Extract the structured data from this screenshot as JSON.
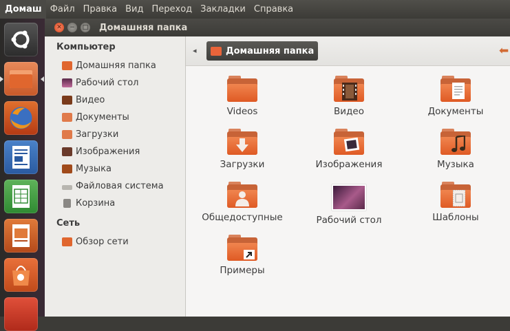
{
  "menubar": {
    "app_name": "Домаш",
    "items": [
      "Файл",
      "Правка",
      "Вид",
      "Переход",
      "Закладки",
      "Справка"
    ]
  },
  "window": {
    "title": "Домашняя папка",
    "controls": [
      "close-icon",
      "minimize-icon",
      "maximize-icon"
    ]
  },
  "launcher": {
    "items": [
      "ubuntu-dash-icon",
      "home-folder-icon",
      "firefox-icon",
      "writer-icon",
      "calc-icon",
      "impress-icon",
      "software-center-icon",
      "help-icon"
    ]
  },
  "sidebar": {
    "computer_header": "Компьютер",
    "computer_items": [
      {
        "label": "Домашняя папка",
        "icon": "home-folder-icon"
      },
      {
        "label": "Рабочий стол",
        "icon": "desktop-icon"
      },
      {
        "label": "Видео",
        "icon": "video-icon"
      },
      {
        "label": "Документы",
        "icon": "documents-icon"
      },
      {
        "label": "Загрузки",
        "icon": "downloads-icon"
      },
      {
        "label": "Изображения",
        "icon": "pictures-icon"
      },
      {
        "label": "Музыка",
        "icon": "music-icon"
      },
      {
        "label": "Файловая система",
        "icon": "filesystem-icon"
      },
      {
        "label": "Корзина",
        "icon": "trash-icon"
      }
    ],
    "network_header": "Сеть",
    "network_items": [
      {
        "label": "Обзор сети",
        "icon": "network-icon"
      }
    ]
  },
  "toolbar": {
    "breadcrumb": "Домашняя папка"
  },
  "files": [
    {
      "name": "Videos",
      "icon": "folder-icon"
    },
    {
      "name": "Видео",
      "icon": "video-folder-icon"
    },
    {
      "name": "Документы",
      "icon": "documents-folder-icon"
    },
    {
      "name": "Загрузки",
      "icon": "downloads-folder-icon"
    },
    {
      "name": "Изображения",
      "icon": "pictures-folder-icon"
    },
    {
      "name": "Музыка",
      "icon": "music-folder-icon"
    },
    {
      "name": "Общедоступные",
      "icon": "public-folder-icon"
    },
    {
      "name": "Рабочий стол",
      "icon": "desktop-folder-icon"
    },
    {
      "name": "Шаблоны",
      "icon": "templates-folder-icon"
    },
    {
      "name": "Примеры",
      "icon": "examples-folder-icon"
    }
  ],
  "colors": {
    "accent": "#e9643a",
    "panel": "#3c3b37",
    "sidebar_bg": "#edece9",
    "content_bg": "#f6f5f4"
  }
}
